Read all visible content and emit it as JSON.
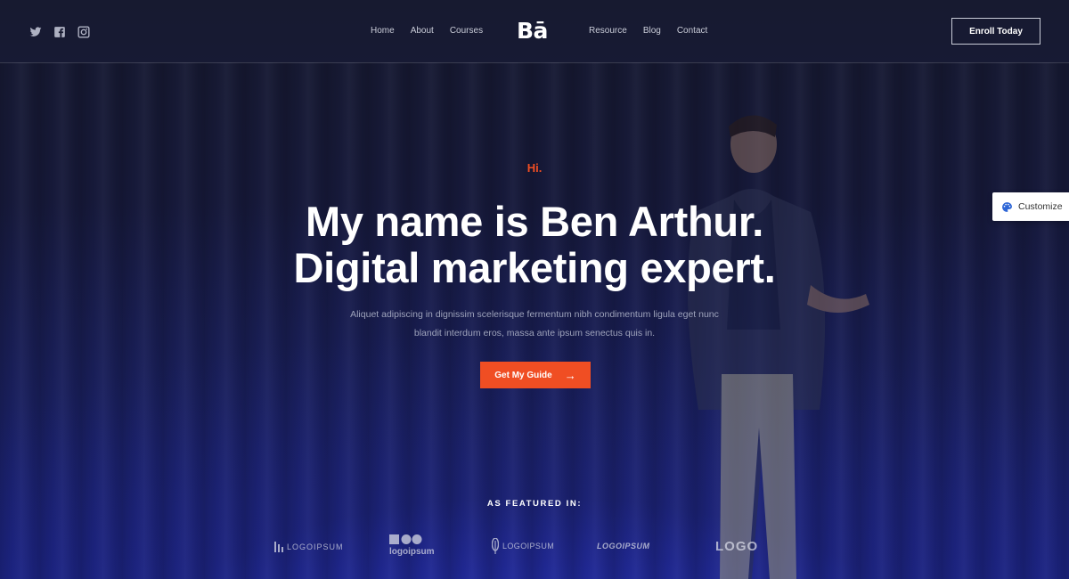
{
  "nav": {
    "socials": [
      "twitter-icon",
      "facebook-icon",
      "instagram-icon"
    ],
    "left_menu": [
      "Home",
      "About",
      "Courses"
    ],
    "brand": "Bā",
    "right_menu": [
      "Resource",
      "Blog",
      "Contact"
    ],
    "enroll_label": "Enroll Today"
  },
  "hero": {
    "eyebrow": "Hi.",
    "headline_line1": "My name is Ben Arthur.",
    "headline_line2": "Digital marketing expert.",
    "subtext_line1": "Aliquet adipiscing in dignissim scelerisque fermentum nibh condimentum ligula eget nunc",
    "subtext_line2": "blandit interdum eros, massa ante ipsum senectus quis in.",
    "cta_label": "Get My Guide"
  },
  "featured": {
    "title": "AS FEATURED IN:",
    "logos": [
      "LOGOIPSUM",
      "logoipsum",
      "LOGOIPSUM",
      "LOGOIPSUM",
      "LOGO"
    ]
  },
  "customize": {
    "label": "Customize"
  },
  "colors": {
    "accent": "#f04e23",
    "background": "#171a30"
  }
}
